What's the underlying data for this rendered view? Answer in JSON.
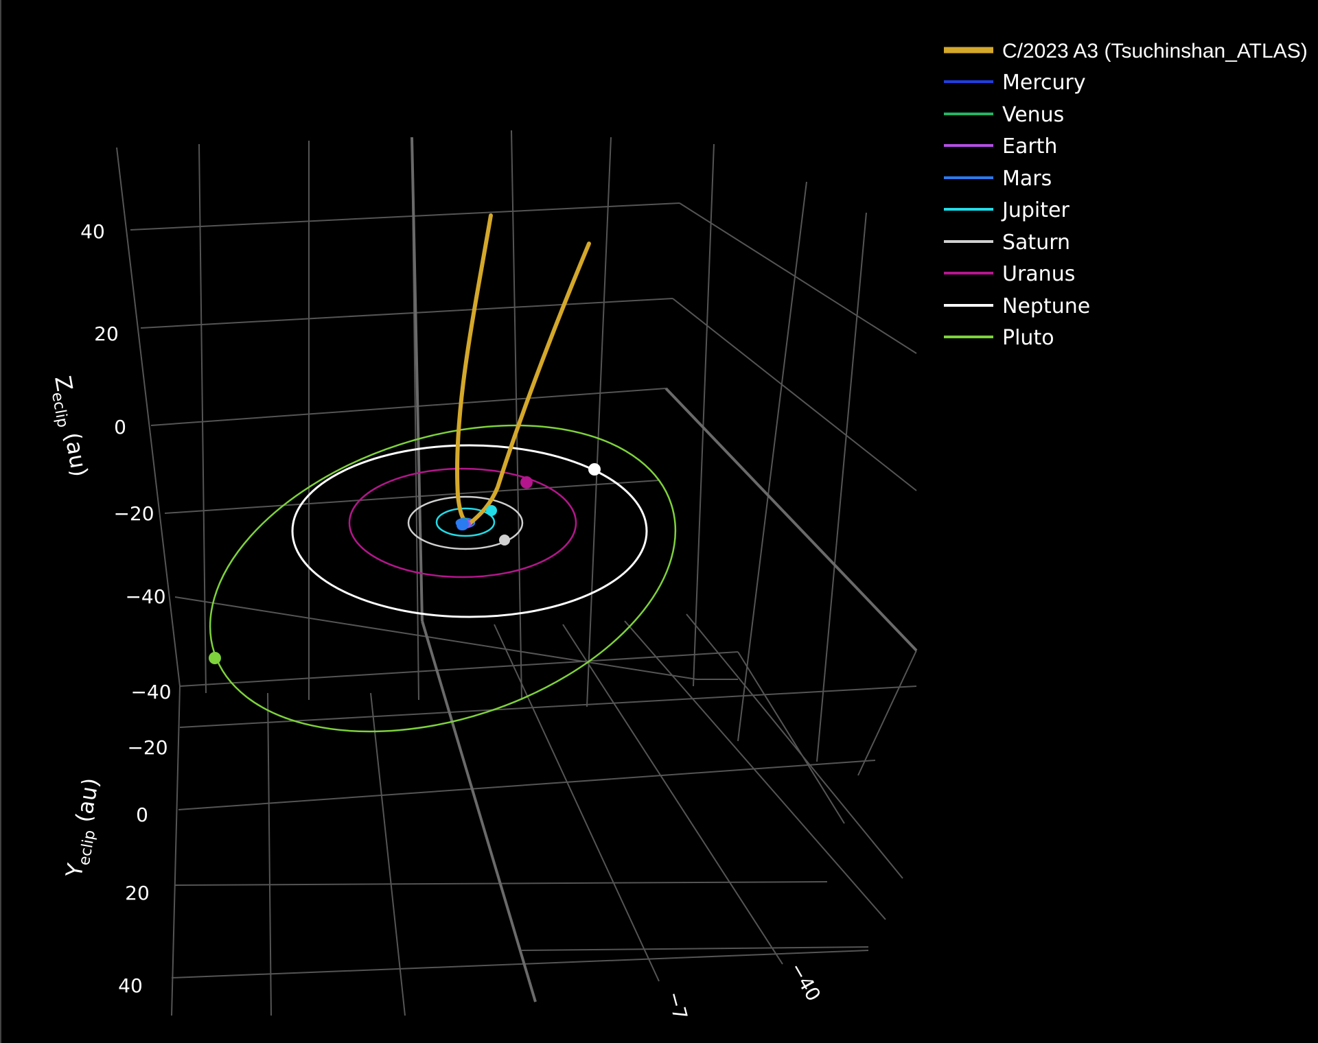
{
  "chart_data": {
    "type": "scatter3d",
    "background": "#000000",
    "grid": true,
    "legend_placement": "top-right",
    "axes": {
      "z": {
        "title_main": "Z",
        "title_sub": "eclip",
        "title_unit": "(au)",
        "ticks": [
          "40",
          "20",
          "0",
          "−20",
          "−40"
        ]
      },
      "y": {
        "title_main": "Y",
        "title_sub": "eclip",
        "title_unit": "(au)",
        "ticks": [
          "−40",
          "−20",
          "0",
          "20",
          "40"
        ]
      },
      "x": {
        "ticks": [
          "−40",
          "−7"
        ]
      }
    },
    "legend": [
      {
        "name": "C/2023 A3 (Tsuchinshan_ATLAS)",
        "color": "#d4a82a",
        "width": 8
      },
      {
        "name": "Mercury",
        "color": "#1f3fe0",
        "width": 4
      },
      {
        "name": "Venus",
        "color": "#22b566",
        "width": 4
      },
      {
        "name": "Earth",
        "color": "#b44fe6",
        "width": 4
      },
      {
        "name": "Mars",
        "color": "#2b7bf0",
        "width": 4
      },
      {
        "name": "Jupiter",
        "color": "#22dde8",
        "width": 4
      },
      {
        "name": "Saturn",
        "color": "#d0d0d0",
        "width": 4
      },
      {
        "name": "Uranus",
        "color": "#b5168d",
        "width": 4
      },
      {
        "name": "Neptune",
        "color": "#ffffff",
        "width": 4
      },
      {
        "name": "Pluto",
        "color": "#7ed23b",
        "width": 4
      }
    ],
    "orbits": [
      {
        "name": "Mercury",
        "color": "#1f3fe0",
        "semi_major_au": 0.39
      },
      {
        "name": "Venus",
        "color": "#22b566",
        "semi_major_au": 0.72
      },
      {
        "name": "Earth",
        "color": "#b44fe6",
        "semi_major_au": 1.0
      },
      {
        "name": "Mars",
        "color": "#2b7bf0",
        "semi_major_au": 1.52
      },
      {
        "name": "Jupiter",
        "color": "#22dde8",
        "semi_major_au": 5.2
      },
      {
        "name": "Saturn",
        "color": "#d0d0d0",
        "semi_major_au": 9.5
      },
      {
        "name": "Uranus",
        "color": "#b5168d",
        "semi_major_au": 19.2
      },
      {
        "name": "Neptune",
        "color": "#ffffff",
        "semi_major_au": 30.1
      },
      {
        "name": "Pluto",
        "color": "#7ed23b",
        "semi_major_au": 39.5
      }
    ],
    "comet": {
      "name": "C/2023 A3 (Tsuchinshan_ATLAS)",
      "color": "#d4a82a",
      "orbit": "hyperbolic"
    }
  }
}
